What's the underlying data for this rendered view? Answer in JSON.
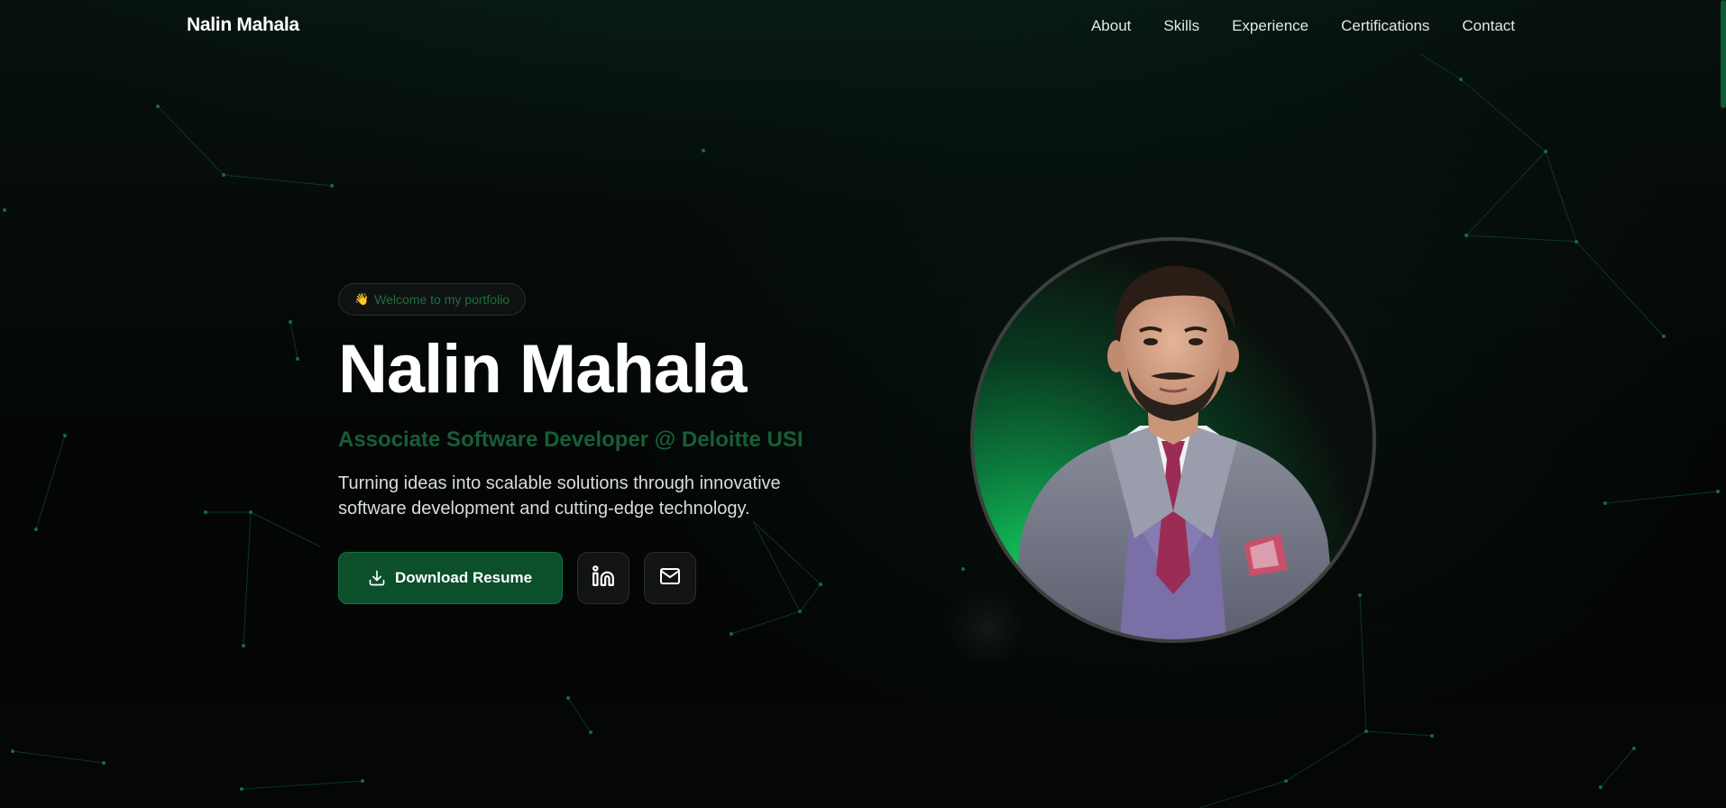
{
  "nav": {
    "brand": "Nalin Mahala",
    "links": [
      "About",
      "Skills",
      "Experience",
      "Certifications",
      "Contact"
    ]
  },
  "hero": {
    "badge_emoji": "👋",
    "badge_text": "Welcome to my portfolio",
    "name": "Nalin Mahala",
    "role": "Associate Software Developer @ Deloitte USI",
    "description": "Turning ideas into scalable solutions through innovative software development and cutting-edge technology.",
    "download_label": "Download Resume",
    "icons": {
      "download": "download-icon",
      "linkedin": "linkedin-icon",
      "email": "mail-icon"
    }
  },
  "portrait": {
    "name": "profile-photo"
  },
  "colors": {
    "accent": "#0b4f2b",
    "accent_text": "#175e36",
    "background": "#050807"
  }
}
